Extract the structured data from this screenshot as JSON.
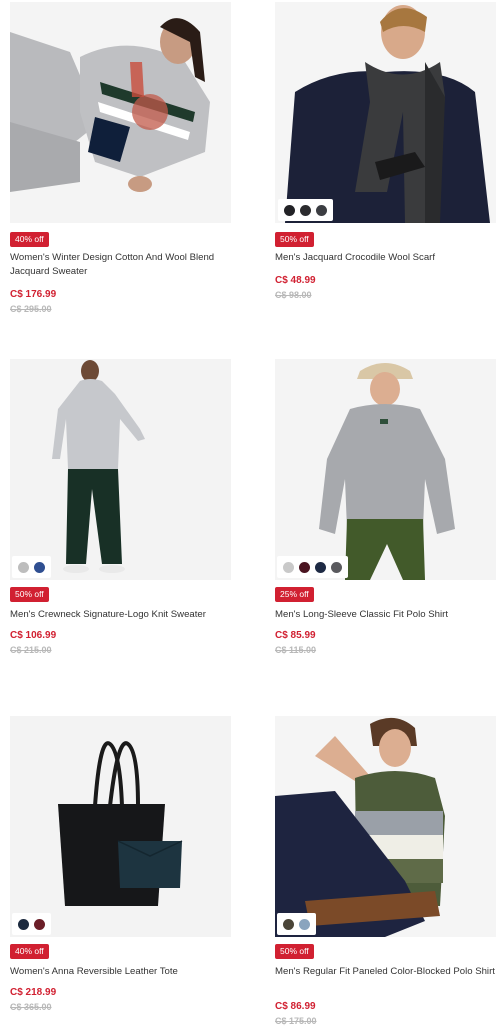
{
  "colors": {
    "accent": "#d12031",
    "old_price": "#b8b8b8",
    "text": "#333333",
    "background": "#ffffff"
  },
  "products": [
    {
      "title": "Women's Winter Design Cotton And Wool Blend Jacquard Sweater",
      "badge": "40% off",
      "price": "C$ 176.99",
      "old_price": "C$ 295.00",
      "swatches": []
    },
    {
      "title": "Men's Jacquard Crocodile Wool Scarf",
      "badge": "50% off",
      "price": "C$ 48.99",
      "old_price": "C$ 98.00",
      "swatches": [
        "#222226",
        "#2b2b2e",
        "#3b3d42"
      ]
    },
    {
      "title": "Men's Crewneck Signature-Logo Knit Sweater",
      "badge": "50% off",
      "price": "C$ 106.99",
      "old_price": "C$ 215.00",
      "swatches": [
        "#bdbdbd",
        "#2f4f91"
      ]
    },
    {
      "title": "Men's Long-Sleeve Classic Fit Polo Shirt",
      "badge": "25% off",
      "price": "C$ 85.99",
      "old_price": "C$ 115.00",
      "swatches": [
        "#c9c9c9",
        "#4a1420",
        "#1e2a44",
        "#5a5a5e"
      ]
    },
    {
      "title": "Women's Anna Reversible Leather Tote",
      "badge": "40% off",
      "price": "C$ 218.99",
      "old_price": "C$ 365.00",
      "swatches": [
        "#1c2a3e",
        "#6b1e28"
      ]
    },
    {
      "title": "Men's Regular Fit Paneled Color-Blocked Polo Shirt",
      "badge": "50% off",
      "price": "C$ 86.99",
      "old_price": "C$ 175.00",
      "swatches": [
        "#4a4538",
        "#8aa4be"
      ]
    }
  ]
}
